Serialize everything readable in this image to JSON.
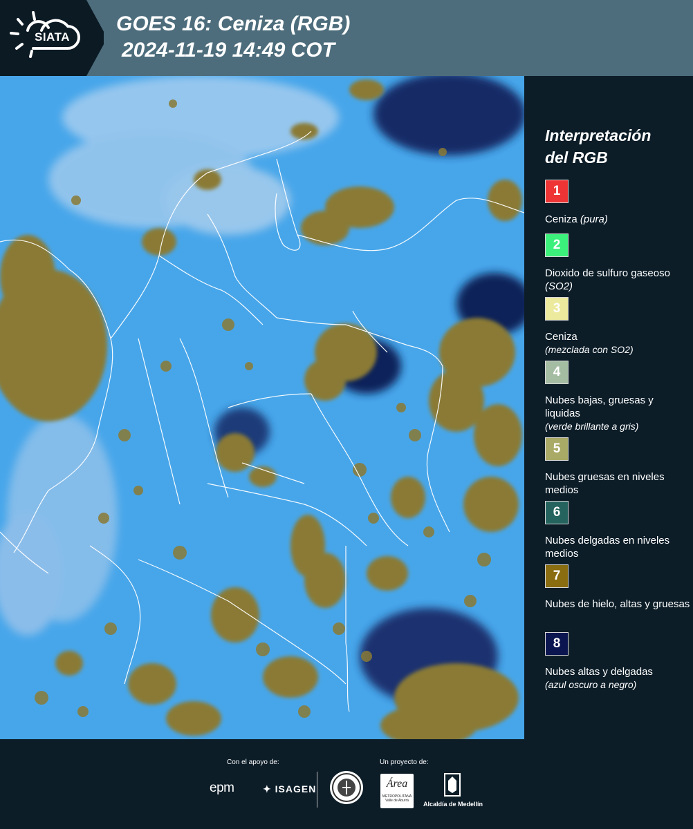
{
  "header": {
    "logo_text": "SIATA",
    "title_line1": "GOES 16: Ceniza (RGB)",
    "title_line2": "2024-11-19 14:49 COT"
  },
  "map": {
    "background_color": "#47a6ea",
    "cloud_color": "#8a7a35",
    "border_color": "#ffffff"
  },
  "legend": {
    "title_line1": "Interpretación",
    "title_line2": "del RGB",
    "items": [
      {
        "number": "1",
        "color": "#ee3434",
        "label": "Ceniza ",
        "sub": "(pura)"
      },
      {
        "number": "2",
        "color": "#3cf07c",
        "label": "Dioxido de sulfuro gaseoso ",
        "sub": "(SO2)"
      },
      {
        "number": "3",
        "color": "#ecea9c",
        "label": "Ceniza",
        "sub": "(mezclada con SO2)"
      },
      {
        "number": "4",
        "color": "#a4bca2",
        "label": "Nubes bajas, gruesas y liquidas",
        "sub": "(verde brillante a gris)"
      },
      {
        "number": "5",
        "color": "#a8aa66",
        "label": "Nubes gruesas en niveles medios",
        "sub": ""
      },
      {
        "number": "6",
        "color": "#24635e",
        "label": "Nubes delgadas en niveles medios",
        "sub": ""
      },
      {
        "number": "7",
        "color": "#8a6d10",
        "label": "Nubes de hielo, altas y gruesas",
        "sub": ""
      },
      {
        "number": "8",
        "color": "#0b1650",
        "label": "Nubes altas y delgadas",
        "sub": "(azul oscuro a negro)"
      }
    ]
  },
  "footer": {
    "support_label": "Con el apoyo de:",
    "project_label": "Un proyecto de:",
    "epm": "epm",
    "isagen": "ISAGEN",
    "alcaldia": "Alcaldía de Medellín",
    "area_line1": "Área",
    "area_line2": "METROPOLITANA",
    "area_line3": "Valle de Aburrá"
  }
}
